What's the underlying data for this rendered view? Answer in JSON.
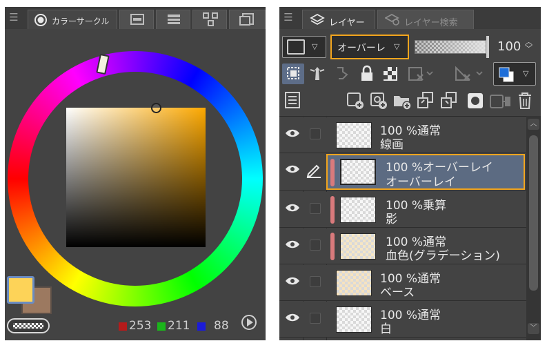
{
  "colorPanel": {
    "tabs": [
      {
        "label": "カラーサークル",
        "icon": "circle-record-icon"
      },
      {
        "icon": "color-slider-icon"
      },
      {
        "icon": "color-set-icon"
      },
      {
        "icon": "intermediate-color-icon"
      },
      {
        "icon": "approximate-color-icon"
      }
    ],
    "rgb": {
      "r": "253",
      "g": "211",
      "b": "88"
    },
    "colors": {
      "main": "#fdd358",
      "sub": "#9c7960",
      "r": "#b51b1b",
      "g": "#1bb51b",
      "b": "#1b1bd8"
    }
  },
  "layerPanel": {
    "tabs": [
      {
        "label": "レイヤー",
        "icon": "layers-icon"
      },
      {
        "label": "レイヤー検索",
        "icon": "layer-search-icon"
      }
    ],
    "blendMode": "オーバーレ",
    "opacity": "100",
    "layers": [
      {
        "opacity": "100 %",
        "blend": "通常",
        "name": "線画",
        "clip": false,
        "selected": false
      },
      {
        "opacity": "100 %",
        "blend": "オーバーレイ",
        "name": "オーバーレイ",
        "clip": true,
        "selected": true
      },
      {
        "opacity": "100 %",
        "blend": "乗算",
        "name": "影",
        "clip": true,
        "selected": false
      },
      {
        "opacity": "100 %",
        "blend": "通常",
        "name": "血色(グラデーション)",
        "clip": true,
        "selected": false
      },
      {
        "opacity": "100 %",
        "blend": "通常",
        "name": "ベース",
        "clip": false,
        "selected": false
      },
      {
        "opacity": "100 %",
        "blend": "通常",
        "name": "白",
        "clip": false,
        "selected": false
      }
    ],
    "accent": "#f2a51d",
    "selectedBg": "#5c6b82"
  }
}
